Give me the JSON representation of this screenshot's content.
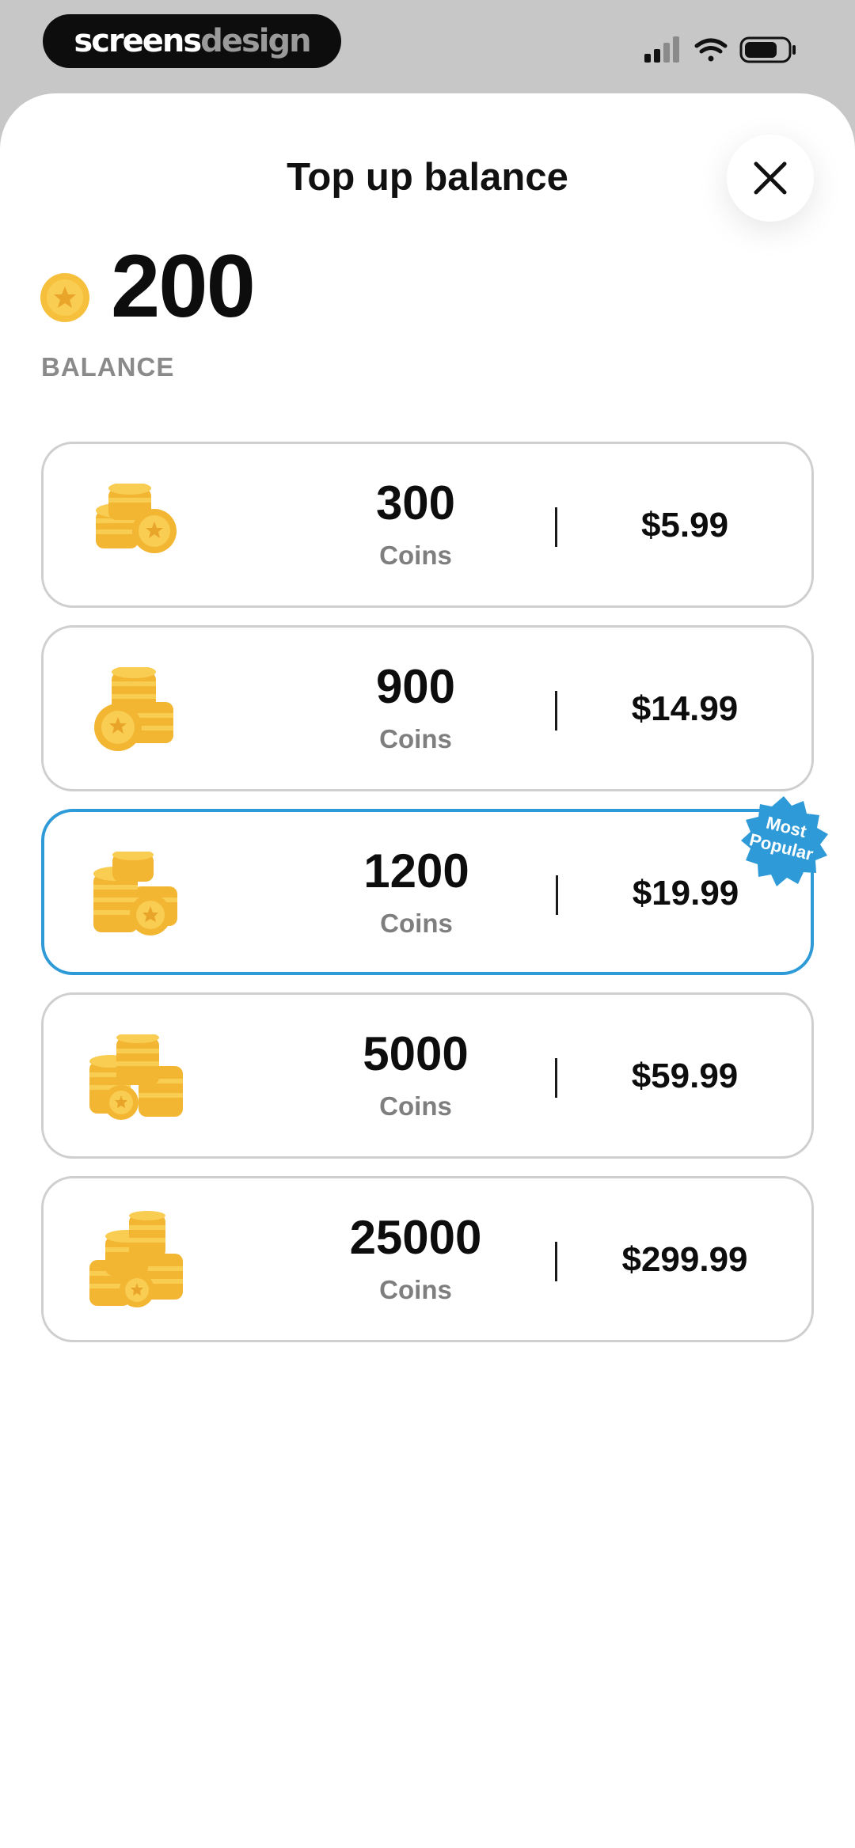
{
  "status_bar": {
    "logo_part1": "screens",
    "logo_part2": "design",
    "icons": [
      "cellular-signal-icon",
      "wifi-icon",
      "battery-icon"
    ]
  },
  "header": {
    "title": "Top up balance",
    "close_icon": "close-icon"
  },
  "balance": {
    "value": "200",
    "label": "BALANCE",
    "icon": "coin-icon"
  },
  "packages": [
    {
      "amount": "300",
      "unit": "Coins",
      "price": "$5.99",
      "icon": "coin-stack-icon"
    },
    {
      "amount": "900",
      "unit": "Coins",
      "price": "$14.99",
      "icon": "coin-stack-icon"
    },
    {
      "amount": "1200",
      "unit": "Coins",
      "price": "$19.99",
      "icon": "coin-stack-icon",
      "badge": "Most Popular",
      "selected": true
    },
    {
      "amount": "5000",
      "unit": "Coins",
      "price": "$59.99",
      "icon": "coin-stack-icon"
    },
    {
      "amount": "25000",
      "unit": "Coins",
      "price": "$299.99",
      "icon": "coin-stack-icon"
    }
  ],
  "colors": {
    "accent": "#2f9ad8",
    "coin": "#f6c03c",
    "background_top": "#c7c7c7",
    "card_border": "#cfcfcf"
  }
}
